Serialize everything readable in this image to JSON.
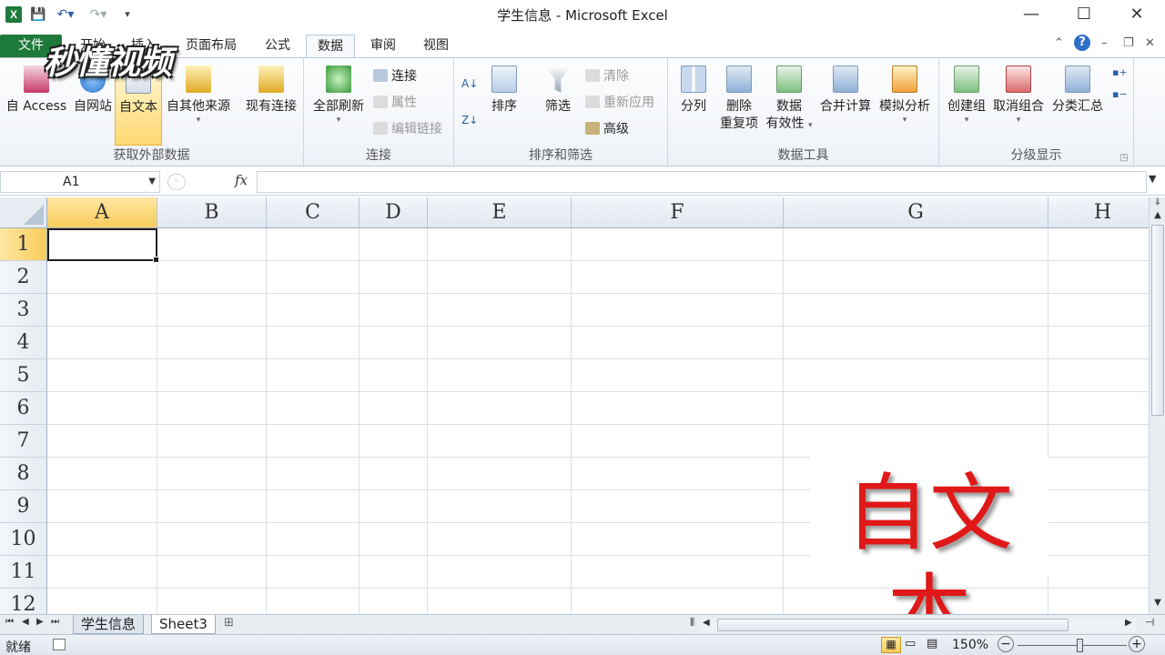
{
  "window": {
    "title": "学生信息 - Microsoft Excel",
    "app_icon": "X",
    "minimize": "—",
    "maximize": "☐",
    "close": "✕"
  },
  "qat": [
    "save-icon",
    "undo-icon",
    "redo-icon",
    "customize-qat-icon"
  ],
  "tabs": [
    {
      "label": "文件"
    },
    {
      "label": "开始"
    },
    {
      "label": "插入"
    },
    {
      "label": "页面布局"
    },
    {
      "label": "公式"
    },
    {
      "label": "数据"
    },
    {
      "label": "审阅"
    },
    {
      "label": "视图"
    }
  ],
  "active_tab": "数据",
  "ribbon": {
    "get_external": {
      "label": "获取外部数据",
      "from_access": "自 Access",
      "from_web": "自网站",
      "from_text": "自文本",
      "from_other": "自其他来源",
      "existing": "现有连接"
    },
    "connections": {
      "label": "连接",
      "refresh_all": "全部刷新",
      "connections": "连接",
      "properties": "属性",
      "edit_links": "编辑链接"
    },
    "sort_filter": {
      "label": "排序和筛选",
      "sort": "排序",
      "filter": "筛选",
      "clear": "清除",
      "reapply": "重新应用",
      "advanced": "高级"
    },
    "data_tools": {
      "label": "数据工具",
      "text_to_columns": "分列",
      "remove_dup_1": "删除",
      "remove_dup_2": "重复项",
      "validation_1": "数据",
      "validation_2": "有效性",
      "consolidate": "合并计算",
      "what_if": "模拟分析"
    },
    "outline": {
      "label": "分级显示",
      "group": "创建组",
      "ungroup": "取消组合",
      "subtotal": "分类汇总"
    }
  },
  "formula_bar": {
    "name_box": "A1",
    "fx": "fx",
    "value": ""
  },
  "columns": [
    "A",
    "B",
    "C",
    "D",
    "E",
    "F",
    "G",
    "H"
  ],
  "rows": [
    "1",
    "2",
    "3",
    "4",
    "5",
    "6",
    "7",
    "8",
    "9",
    "10",
    "11",
    "12"
  ],
  "sheets": [
    {
      "name": "学生信息"
    },
    {
      "name": "Sheet3"
    }
  ],
  "active_sheet": "Sheet3",
  "status": {
    "ready": "就绪",
    "zoom": "150%"
  },
  "overlay_caption": "自文本",
  "watermark": "秒懂视频"
}
